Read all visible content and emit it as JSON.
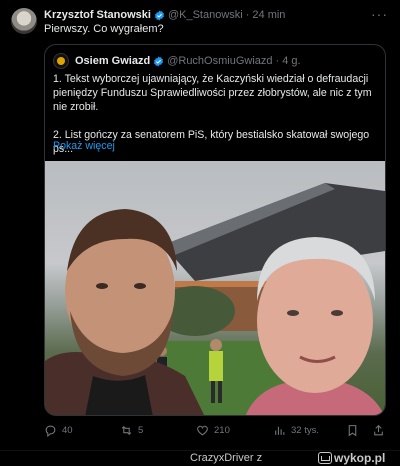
{
  "tweet": {
    "author_name": "Krzysztof Stanowski",
    "author_handle": "@K_Stanowski",
    "separator": "·",
    "time": "24 min",
    "text": "Pierwszy. Co wygrałem?",
    "more_icon": "more-horizontal-icon"
  },
  "quote": {
    "author_name": "Osiem Gwiazd",
    "author_handle": "@RuchOsmiuGwiazd",
    "separator": "·",
    "time": "4 g.",
    "paragraph_1": "1. Tekst wyborczej ujawniający, że Kaczyński wiedział o defraudacji pieniędzy Funduszu Sprawiedliwości przez złobrystów, ale nic z tym nie zrobił.",
    "paragraph_2": "2. List gończy za senatorem PiS, który bestialsko skatował swojego ps...",
    "show_more": "Pokaż więcej"
  },
  "actions": {
    "replies": "40",
    "retweets": "5",
    "likes": "210",
    "views": "32 tys."
  },
  "footer": {
    "user": "CrazyxDriver z",
    "site": "wykop.pl"
  },
  "colors": {
    "background": "#000000",
    "text": "#e7e9ea",
    "muted": "#71767b",
    "link": "#1d9bf0",
    "verified": "#1d9bf0"
  }
}
